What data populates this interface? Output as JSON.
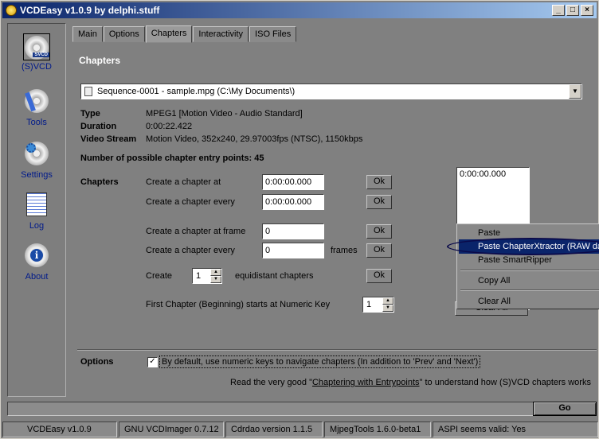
{
  "window": {
    "title": "VCDEasy v1.0.9 by delphi.stuff",
    "min": "_",
    "max": "□",
    "close": "×"
  },
  "sidebar": {
    "items": [
      {
        "label": "(S)VCD",
        "icon": "disc-icon"
      },
      {
        "label": "Tools",
        "icon": "tools-icon"
      },
      {
        "label": "Settings",
        "icon": "settings-icon"
      },
      {
        "label": "Log",
        "icon": "log-icon"
      },
      {
        "label": "About",
        "icon": "info-icon"
      }
    ]
  },
  "tabs": [
    "Main",
    "Options",
    "Chapters",
    "Interactivity",
    "ISO Files"
  ],
  "active_tab": "Chapters",
  "section_title": "Chapters",
  "sequence": {
    "value": "Sequence-0001 - sample.mpg  (C:\\My Documents\\)"
  },
  "info": {
    "type_label": "Type",
    "type_value": "MPEG1   [Motion Video - Audio Standard]",
    "duration_label": "Duration",
    "duration_value": "0:00:22.422",
    "video_label": "Video Stream",
    "video_value": "Motion Video, 352x240, 29.97003fps (NTSC), 1150kbps",
    "entry_points": "Number of possible chapter entry points: 45"
  },
  "chapters": {
    "label": "Chapters",
    "at_label": "Create a chapter at",
    "at_value": "0:00:00.000",
    "every_label": "Create a chapter every",
    "every_value": "0:00:00.000",
    "at_frame_label": "Create a chapter at frame",
    "at_frame_value": "0",
    "every_frames_label": "Create a chapter every",
    "every_frames_value": "0",
    "frames_label": "frames",
    "create_label": "Create",
    "create_value": "1",
    "equidistant_label": "equidistant chapters",
    "first_label": "First Chapter (Beginning) starts at Numeric Key",
    "first_value": "1",
    "ok": "Ok",
    "list": [
      "0:00:00.000"
    ],
    "clear_all_button": "Clear All"
  },
  "context_menu": {
    "paste": "Paste",
    "paste_chapterxtractor": "Paste ChapterXtractor (RAW da",
    "paste_smartripper": "Paste SmartRipper",
    "copy_all": "Copy All",
    "clear_all": "Clear All"
  },
  "options": {
    "label": "Options",
    "checkbox_text": "By default, use numeric keys to navigate chapters (In addition to 'Prev' and 'Next')",
    "checked": true,
    "read_pre": "Read the very good \"",
    "read_link": "Chaptering with Entrypoints",
    "read_post": "\" to understand how (S)VCD chapters works"
  },
  "go_button": "Go",
  "status": [
    "VCDEasy v1.0.9",
    "GNU VCDImager 0.7.12",
    "Cdrdao version 1.1.5",
    "MjpegTools 1.6.0-beta1",
    "ASPI seems valid: Yes"
  ]
}
